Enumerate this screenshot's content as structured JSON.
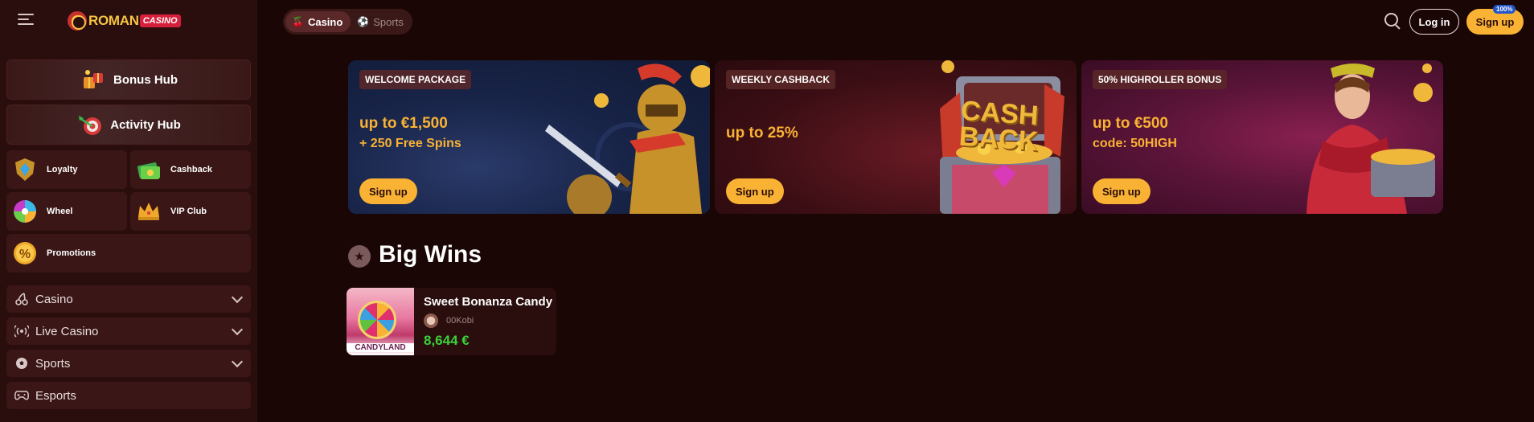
{
  "brand": {
    "name_part1": "ROMAN",
    "name_part2": "CASINO"
  },
  "sidebar": {
    "hubs": [
      {
        "label": "Bonus Hub"
      },
      {
        "label": "Activity Hub"
      }
    ],
    "tiles": [
      {
        "label": "Loyalty"
      },
      {
        "label": "Cashback"
      },
      {
        "label": "Wheel"
      },
      {
        "label": "VIP Club"
      },
      {
        "label": "Promotions"
      }
    ],
    "nav": [
      {
        "label": "Casino"
      },
      {
        "label": "Live Casino"
      },
      {
        "label": "Sports"
      },
      {
        "label": "Esports"
      }
    ]
  },
  "topbar": {
    "tabs": [
      {
        "label": "Casino",
        "active": true
      },
      {
        "label": "Sports",
        "active": false
      }
    ],
    "login_label": "Log in",
    "signup_label": "Sign up",
    "signup_badge": "100%"
  },
  "promos": [
    {
      "tag": "WELCOME PACKAGE",
      "headline": "up to €1,500",
      "subline": "+ 250 Free Spins",
      "cta": "Sign up"
    },
    {
      "tag": "WEEKLY CASHBACK",
      "headline": "up to 25%",
      "subline": "",
      "cta": "Sign up",
      "art_text": [
        "CASH",
        "BACK"
      ]
    },
    {
      "tag": "50% HIGHROLLER BONUS",
      "headline": "up to €500",
      "subline": "code: 50HIGH",
      "cta": "Sign up"
    }
  ],
  "big_wins": {
    "title": "Big Wins",
    "items": [
      {
        "game": "Sweet Bonanza Candyland",
        "thumb_caption": "CANDYLAND",
        "user": "00Kobi",
        "amount": "8,644 €"
      }
    ]
  },
  "colors": {
    "accent": "#f9b233",
    "win_green": "#3ad13a",
    "background": "#1b0606",
    "sidebar": "#2a0d0d"
  }
}
